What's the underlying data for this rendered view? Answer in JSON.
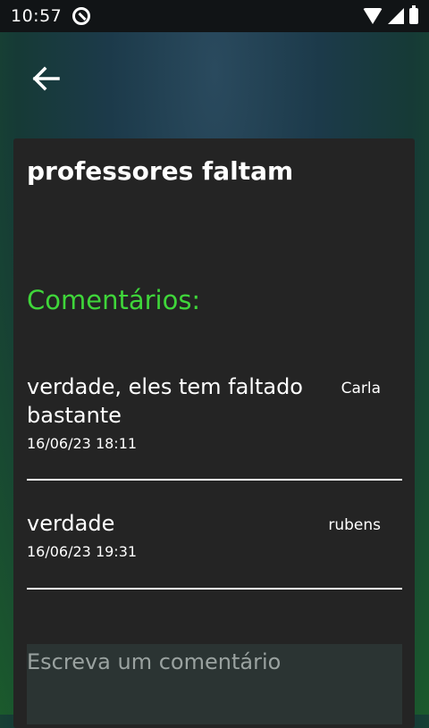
{
  "status_bar": {
    "time": "10:57",
    "icons": [
      "app-notification-icon",
      "wifi-icon",
      "signal-icon",
      "battery-icon"
    ]
  },
  "header": {
    "back_icon": "arrow-left-icon"
  },
  "post": {
    "title": "professores faltam"
  },
  "comments_section": {
    "heading": "Comentários:",
    "items": [
      {
        "text": "verdade, eles tem faltado bastante",
        "author": "Carla",
        "date": "16/06/23 18:11"
      },
      {
        "text": "verdade",
        "author": "rubens",
        "date": "16/06/23 19:31"
      }
    ]
  },
  "comment_input": {
    "placeholder": "Escreva um comentário",
    "value": ""
  },
  "colors": {
    "accent": "#3fd63a",
    "card": "#242424",
    "input_bg": "#2b3433"
  }
}
